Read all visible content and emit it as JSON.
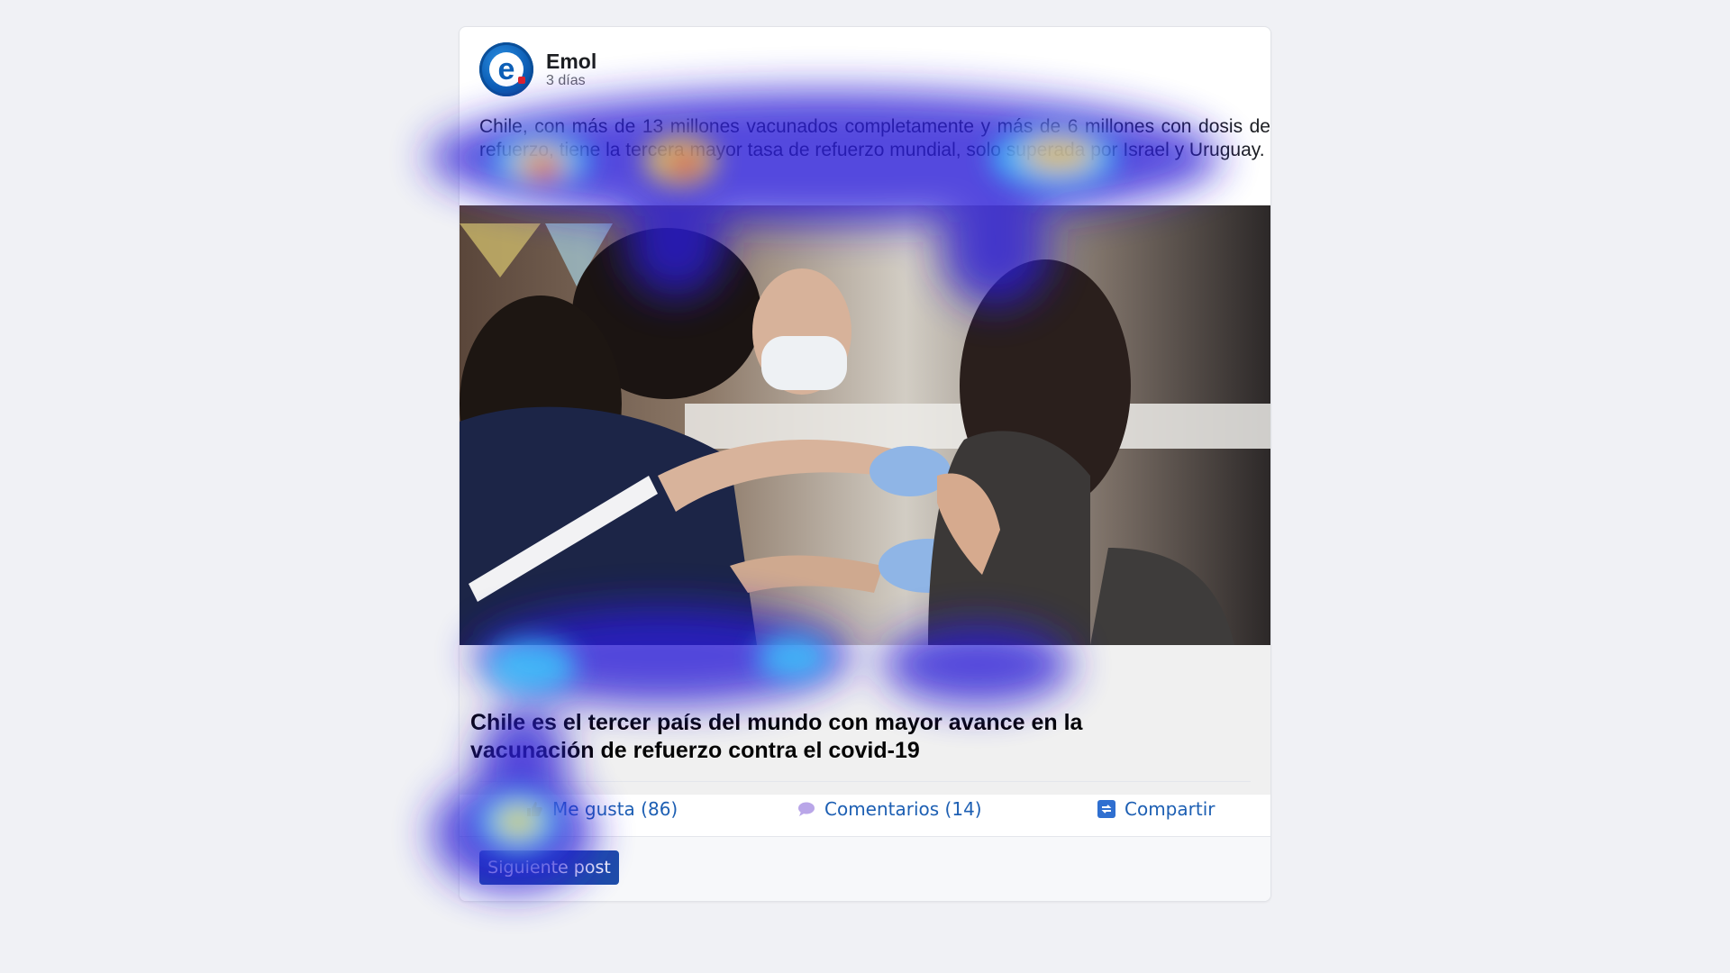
{
  "post": {
    "author": "Emol",
    "avatar_letter": "e",
    "time": "3 días",
    "text": "Chile, con más de 13 millones vacunados completamente y más de 6 millones con dosis de refuerzo, tiene la tercera mayor tasa de refuerzo mundial, solo superada por Israel y Uruguay.",
    "link_title": "Chile es el tercer país del mundo con mayor avance en la vacunación de refuerzo contra el covid-19"
  },
  "actions": {
    "like": "Me gusta (86)",
    "comment": "Comentarios (14)",
    "share": "Compartir"
  },
  "footer": {
    "next_label": "Siguiente post"
  },
  "icons": {
    "like": "thumbs-up-icon",
    "comment": "speech-bubble-icon",
    "share": "share-icon"
  },
  "colors": {
    "accent": "#1d5fb3",
    "button": "#1f4ea8",
    "background": "#f0f1f5"
  }
}
